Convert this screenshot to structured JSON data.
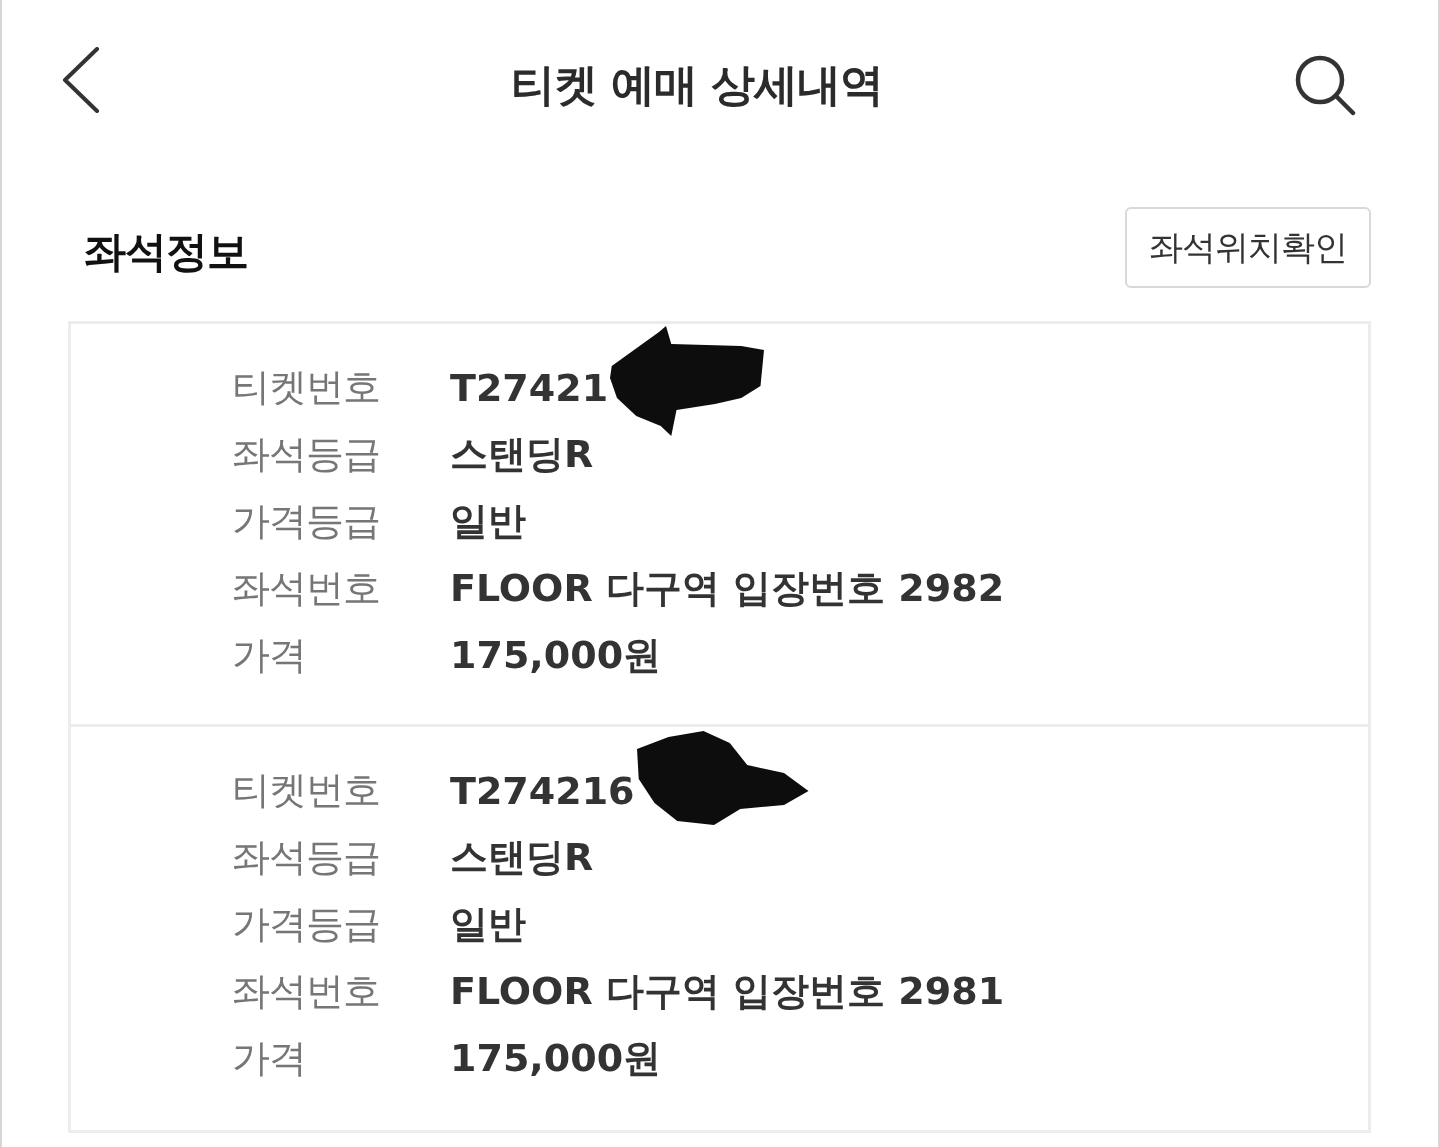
{
  "header": {
    "title": "티켓 예매 상세내역"
  },
  "section": {
    "title": "좌석정보",
    "button": "좌석위치확인"
  },
  "tickets": [
    {
      "rows": [
        {
          "label": "티켓번호",
          "value": "T27421",
          "redacted": true
        },
        {
          "label": "좌석등급",
          "value": "스탠딩R",
          "redacted": false
        },
        {
          "label": "가격등급",
          "value": "일반",
          "redacted": false
        },
        {
          "label": "좌석번호",
          "value": "FLOOR 다구역 입장번호 2982",
          "redacted": false
        },
        {
          "label": "가격",
          "value": "175,000원",
          "redacted": false
        }
      ]
    },
    {
      "rows": [
        {
          "label": "티켓번호",
          "value": "T274216",
          "redacted": true
        },
        {
          "label": "좌석등급",
          "value": "스탠딩R",
          "redacted": false
        },
        {
          "label": "가격등급",
          "value": "일반",
          "redacted": false
        },
        {
          "label": "좌석번호",
          "value": "FLOOR 다구역 입장번호 2981",
          "redacted": false
        },
        {
          "label": "가격",
          "value": "175,000원",
          "redacted": false
        }
      ]
    }
  ]
}
